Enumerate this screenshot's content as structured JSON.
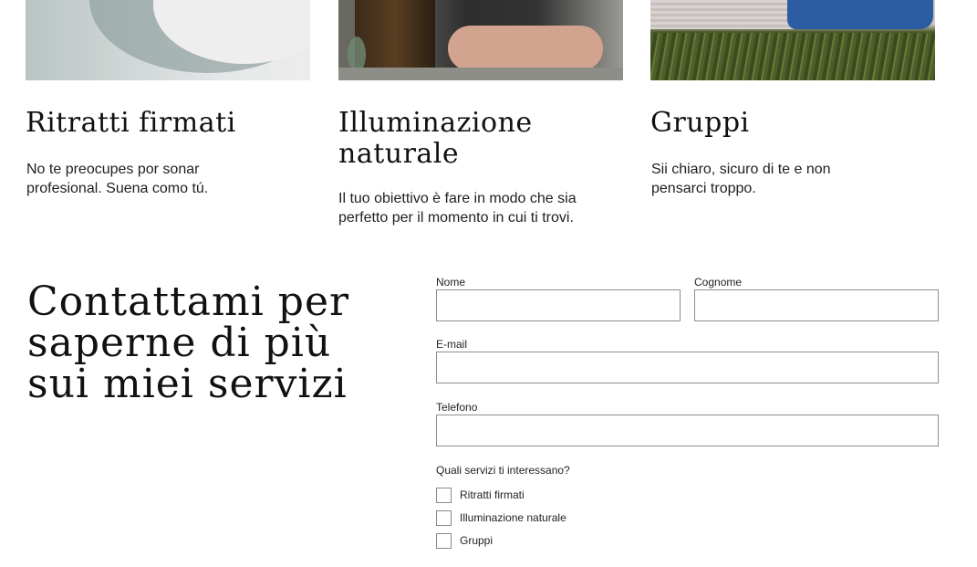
{
  "cards": [
    {
      "title": "Ritratti firmati",
      "text": "No te preocupes por sonar profesional. Suena como tú.",
      "image_icon": "portrait-photo"
    },
    {
      "title": "Illuminazione naturale",
      "text": "Il tuo obiettivo è fare in modo che sia perfetto per il momento in cui ti trovi.",
      "image_icon": "natural-light-photo"
    },
    {
      "title": "Gruppi",
      "text": "Sii chiaro, sicuro di te e non pensarci troppo.",
      "image_icon": "group-photo"
    }
  ],
  "contact": {
    "title": "Contattami per saperne di più sui miei servizi"
  },
  "form": {
    "first_name": {
      "label": "Nome",
      "value": ""
    },
    "last_name": {
      "label": "Cognome",
      "value": ""
    },
    "email": {
      "label": "E-mail",
      "value": ""
    },
    "phone": {
      "label": "Telefono",
      "value": ""
    },
    "services_question": "Quali servizi ti interessano?",
    "services": [
      {
        "label": "Ritratti firmati",
        "checked": false
      },
      {
        "label": "Illuminazione naturale",
        "checked": false
      },
      {
        "label": "Gruppi",
        "checked": false
      }
    ]
  },
  "colors": {
    "text": "#111111",
    "input_border": "#8f8f8f",
    "background": "#ffffff"
  }
}
